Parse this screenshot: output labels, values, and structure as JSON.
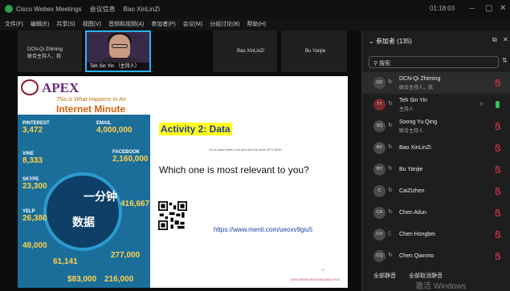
{
  "window": {
    "app_title": "Cisco Webex Meetings",
    "meeting_info": "会议信息",
    "speaker_indicator": "Bao XinLinZi",
    "clock": "01:18:03",
    "minimize": "–",
    "maximize": "▢",
    "close": "✕"
  },
  "menu": [
    "文件(F)",
    "编辑(E)",
    "共享(S)",
    "视图(V)",
    "音频和视频(A)",
    "参加者(P)",
    "会议(M)",
    "分组讨论(B)",
    "帮助(H)"
  ],
  "video_strip": [
    {
      "name": "DCN-Qi Zhiming",
      "role": "联合主持人，我"
    },
    {
      "name": "Teh Sin Yin",
      "role": "（主持人）"
    },
    {
      "name": "Bao XinLinZi"
    },
    {
      "name": "Bu Yanjie"
    }
  ],
  "slide": {
    "apex": "APEX",
    "sub1": "This is What Happens In An",
    "sub2": "Internet Minute",
    "infographic": {
      "center_top": "一分钟",
      "center_bottom": "数据",
      "stats": [
        {
          "label": "PINTEREST",
          "value": "3,472"
        },
        {
          "label": "VINE",
          "value": "8,333"
        },
        {
          "label": "SKYPE",
          "value": "23,300"
        },
        {
          "label": "YELP",
          "value": "26,380"
        },
        {
          "label": "",
          "value": "48,000"
        },
        {
          "label": "",
          "value": "61,141"
        },
        {
          "label": "",
          "value": "$83,000"
        },
        {
          "label": "EMAIL",
          "value": "4,000,000"
        },
        {
          "label": "FACEBOOK",
          "value": "2,160,000"
        },
        {
          "label": "",
          "value": "416,667"
        },
        {
          "label": "",
          "value": "277,000"
        },
        {
          "label": "",
          "value": "216,000"
        }
      ]
    },
    "activity": "Activity 2: Data",
    "menti_line": "Go to www.menti.com and use the code 4974 5930",
    "question": "Which one is most relevant to you?",
    "link": "https://www.menti.com/ueoxv9giu5",
    "page": "22",
    "footnote": "DATA DRIVEN DECISION ANALYTICS"
  },
  "panel": {
    "title": "参加者 (135)",
    "search_placeholder": "搜索",
    "participants": [
      {
        "initials": "DZ",
        "name": "DCN-Qi Zhiming",
        "role": "联合主持人，我",
        "mic": "off",
        "selected": true
      },
      {
        "initials": "TY",
        "name": "Teh Sin Yin",
        "role": "主持人",
        "mic": "on",
        "chat": true
      },
      {
        "initials": "SQ",
        "name": "Soong Yu Qing",
        "role": "联合主持人",
        "mic": "off"
      },
      {
        "initials": "BX",
        "name": "Bao XinLinZi",
        "role": "",
        "mic": "off"
      },
      {
        "initials": "BY",
        "name": "Bu Yanjie",
        "role": "",
        "mic": "off"
      },
      {
        "initials": "C",
        "name": "CaiZizhen",
        "role": "",
        "mic": "off"
      },
      {
        "initials": "CA",
        "name": "Chen Ailun",
        "role": "",
        "mic": "off"
      },
      {
        "initials": "CH",
        "name": "Chen Hongbei",
        "role": "",
        "mic": "off"
      },
      {
        "initials": "CQ",
        "name": "Chen Qianmo",
        "role": "",
        "mic": "off"
      }
    ],
    "mute_all": "全部静音",
    "unmute_all": "全部取消静音",
    "watermark": "激活 Windows"
  }
}
